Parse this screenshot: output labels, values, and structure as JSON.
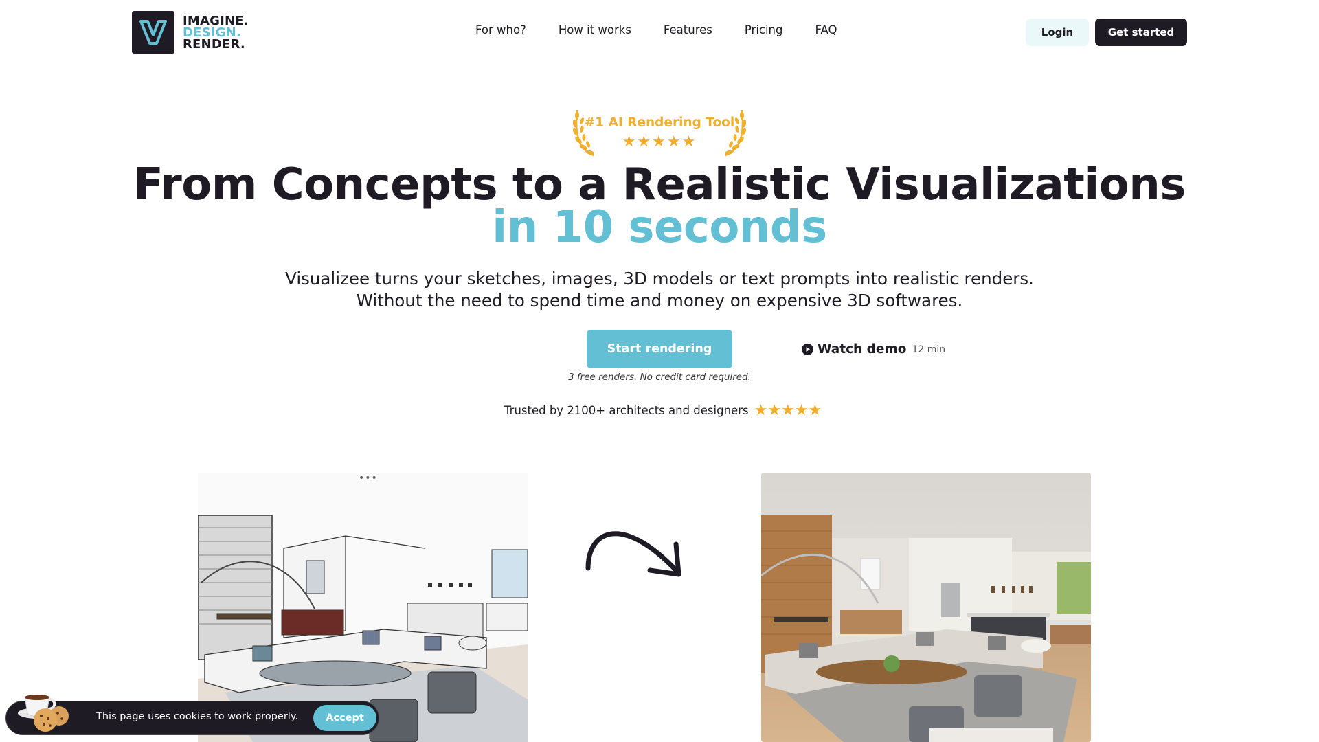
{
  "header": {
    "logo": {
      "line1": "IMAGINE.",
      "line2": "DESIGN.",
      "line3": "RENDER.",
      "mark": "V"
    },
    "nav": [
      {
        "label": "For who?"
      },
      {
        "label": "How it works"
      },
      {
        "label": "Features"
      },
      {
        "label": "Pricing"
      },
      {
        "label": "FAQ"
      }
    ],
    "login_label": "Login",
    "get_started_label": "Get started"
  },
  "badge": {
    "text": "#1 AI Rendering Tool",
    "stars": "★★★★★",
    "rating": 5
  },
  "hero": {
    "headline": "From Concepts to a Realistic Visualizations",
    "headline_accent": "in 10 seconds",
    "subtitle_line1": "Visualizee turns your sketches, images, 3D models or text prompts into realistic renders.",
    "subtitle_line2": "Without the need to spend time and money on expensive 3D softwares.",
    "cta_label": "Start rendering",
    "watch_label": "Watch demo",
    "watch_duration": "12 min",
    "note": "3 free renders. No credit card required.",
    "trusted_text": "Trusted by 2100+ architects and designers",
    "trusted_stars": "★★★★★",
    "trusted_rating": 5
  },
  "showcase": {
    "before_alt": "Sketch of living room interior",
    "after_alt": "Realistic render of living room interior",
    "dots": "•••"
  },
  "cookie": {
    "text": "This page uses cookies to work properly.",
    "accept_label": "Accept"
  },
  "colors": {
    "brand_dark": "#1e1b24",
    "accent": "#62bfd4",
    "star": "#f3ad2a",
    "login_bg": "#ebf8fa"
  }
}
